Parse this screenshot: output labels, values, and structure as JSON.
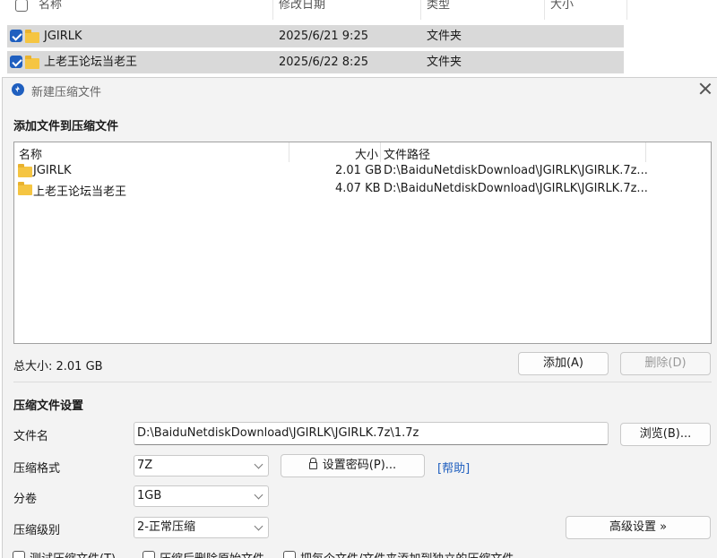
{
  "explorer": {
    "columns": {
      "name": "名称",
      "modified": "修改日期",
      "type": "类型",
      "size": "大小"
    },
    "rows": [
      {
        "name": "JGIRLK",
        "modified": "2025/6/21 9:25",
        "type": "文件夹"
      },
      {
        "name": "上老王论坛当老王",
        "modified": "2025/6/22 8:25",
        "type": "文件夹"
      }
    ]
  },
  "dialog": {
    "title": "新建压缩文件",
    "section_add": "添加文件到压缩文件",
    "list_headers": {
      "name": "名称",
      "size": "大小",
      "path": "文件路径"
    },
    "files": [
      {
        "name": "JGIRLK",
        "size": "2.01 GB",
        "path": "D:\\BaiduNetdiskDownload\\JGIRLK\\JGIRLK.7z..."
      },
      {
        "name": "上老王论坛当老王",
        "size": "4.07 KB",
        "path": "D:\\BaiduNetdiskDownload\\JGIRLK\\JGIRLK.7z..."
      }
    ],
    "total_size": "总大小: 2.01 GB",
    "add_button": "添加(A)",
    "delete_button": "删除(D)",
    "section_settings": "压缩文件设置",
    "filename_label": "文件名",
    "filename_value": "D:\\BaiduNetdiskDownload\\JGIRLK\\JGIRLK.7z\\1.7z",
    "browse_button": "浏览(B)...",
    "format_label": "压缩格式",
    "format_value": "7Z",
    "password_button": "设置密码(P)...",
    "help_link": "[帮助]",
    "split_label": "分卷",
    "split_value": "1GB",
    "level_label": "压缩级别",
    "level_value": "2-正常压缩",
    "advanced_button": "高级设置 »",
    "options": [
      "测试压缩文件(T)",
      "压缩后删除原始文件",
      "把每个文件/文件夹添加到独立的压缩文件"
    ]
  },
  "colors": {
    "accent": "#1f5fbf",
    "selected_row": "#d9d9d9",
    "dialog_bg": "#f3f3f3"
  }
}
